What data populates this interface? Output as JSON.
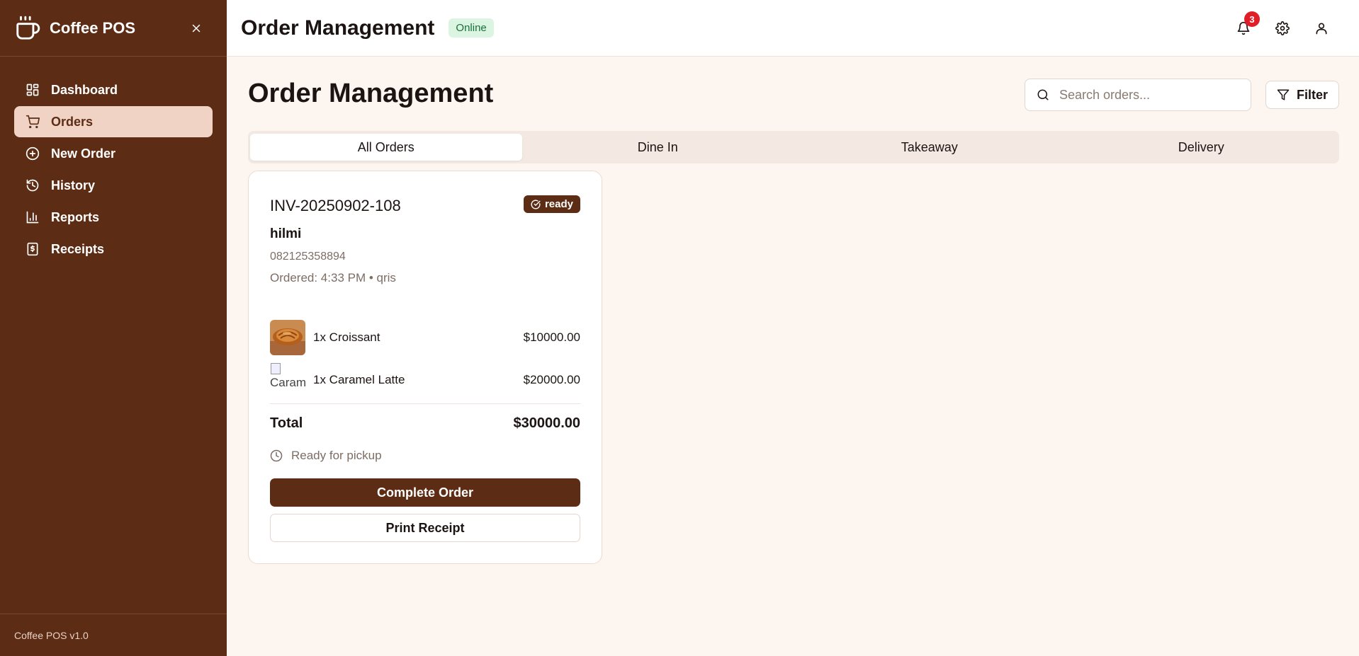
{
  "sidebar": {
    "brand": "Coffee POS",
    "items": [
      {
        "label": "Dashboard",
        "icon": "dashboard-icon"
      },
      {
        "label": "Orders",
        "icon": "cart-icon",
        "active": true
      },
      {
        "label": "New Order",
        "icon": "plus-circle-icon"
      },
      {
        "label": "History",
        "icon": "history-icon"
      },
      {
        "label": "Reports",
        "icon": "bar-chart-icon"
      },
      {
        "label": "Receipts",
        "icon": "receipt-icon"
      }
    ],
    "footer": "Coffee POS v1.0"
  },
  "header": {
    "title": "Order Management",
    "status": "Online",
    "notification_count": "3"
  },
  "main": {
    "title": "Order Management",
    "search_placeholder": "Search orders...",
    "filter_label": "Filter",
    "tabs": [
      {
        "label": "All Orders",
        "active": true
      },
      {
        "label": "Dine In"
      },
      {
        "label": "Takeaway"
      },
      {
        "label": "Delivery"
      }
    ]
  },
  "order": {
    "invoice": "INV-20250902-108",
    "status": "ready",
    "customer_name": "hilmi",
    "phone": "082125358894",
    "ordered": "Ordered: 4:33 PM • qris",
    "items": [
      {
        "desc": "1x Croissant",
        "price": "$10000.00"
      },
      {
        "desc": "1x Caramel Latte",
        "price": "$20000.00",
        "alt": "Caram"
      }
    ],
    "total_label": "Total",
    "total_value": "$30000.00",
    "pickup_note": "Ready for pickup",
    "complete_label": "Complete Order",
    "print_label": "Print Receipt"
  },
  "colors": {
    "sidebar_bg": "#5c2c14",
    "active_nav": "#f0d3c4",
    "page_bg": "#fdf5f0",
    "online_badge": "#dcf5e3",
    "notification": "#e11d28"
  }
}
